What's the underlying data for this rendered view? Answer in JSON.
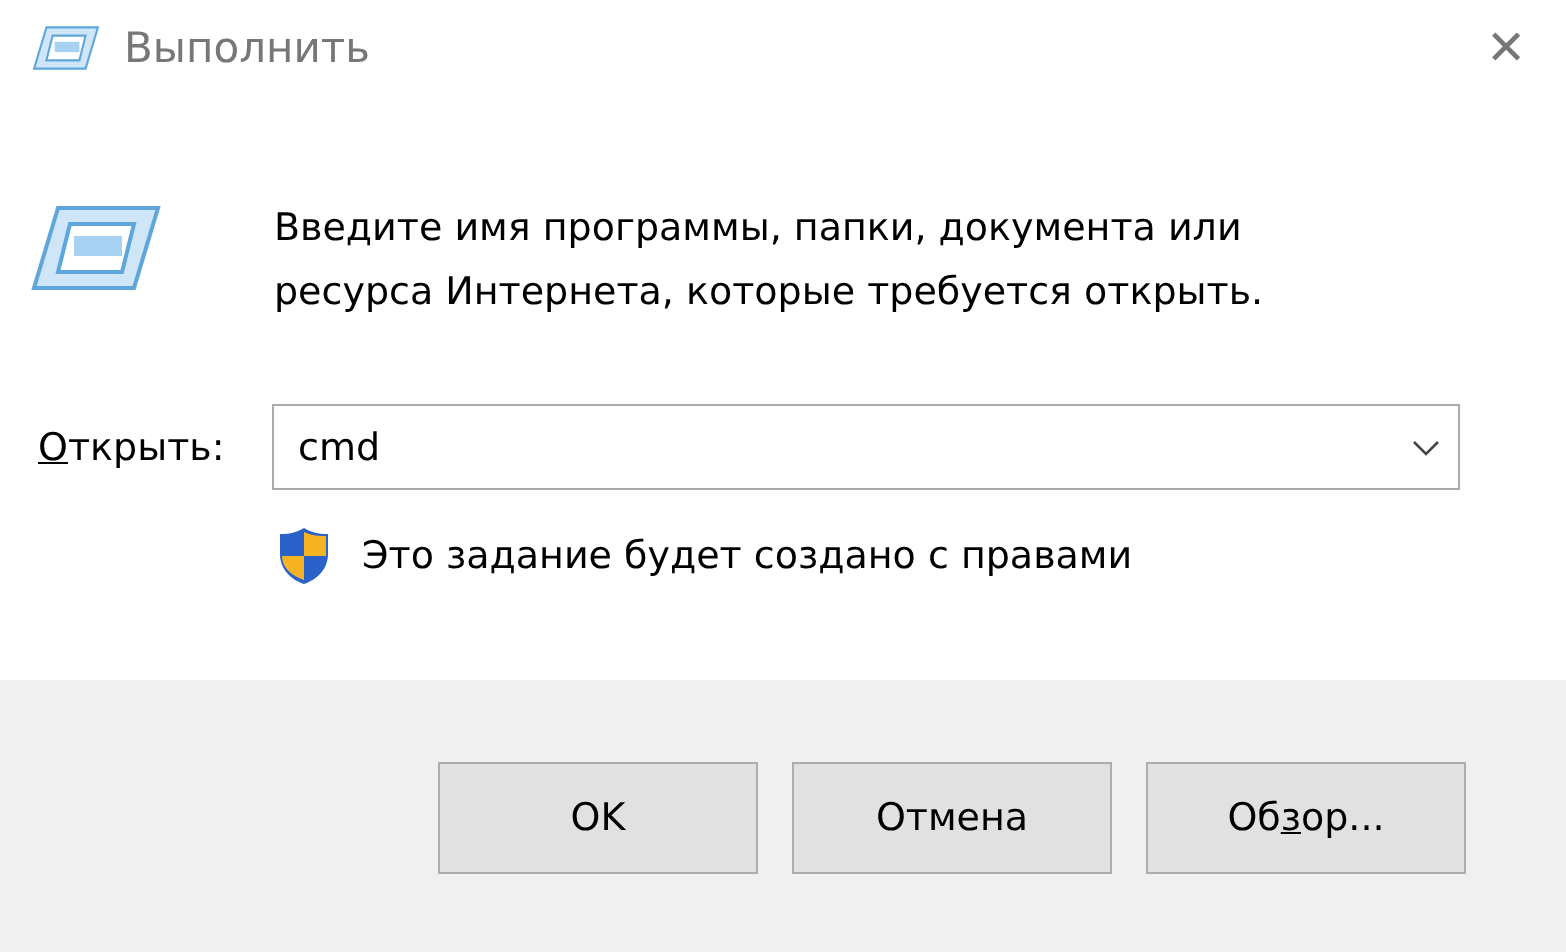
{
  "window": {
    "title": "Выполнить",
    "close": "✕"
  },
  "description": "Введите имя программы, папки, документа или ресурса Интернета, которые требуется открыть.",
  "open_field": {
    "label": {
      "key": "О",
      "after": "ткрыть:"
    },
    "value": "cmd"
  },
  "admin_note": "Это задание будет создано с правами",
  "buttons": [
    {
      "before": "OK"
    },
    {
      "before": "Отмена"
    },
    {
      "before": "Об",
      "key": "з",
      "after": "ор..."
    }
  ]
}
